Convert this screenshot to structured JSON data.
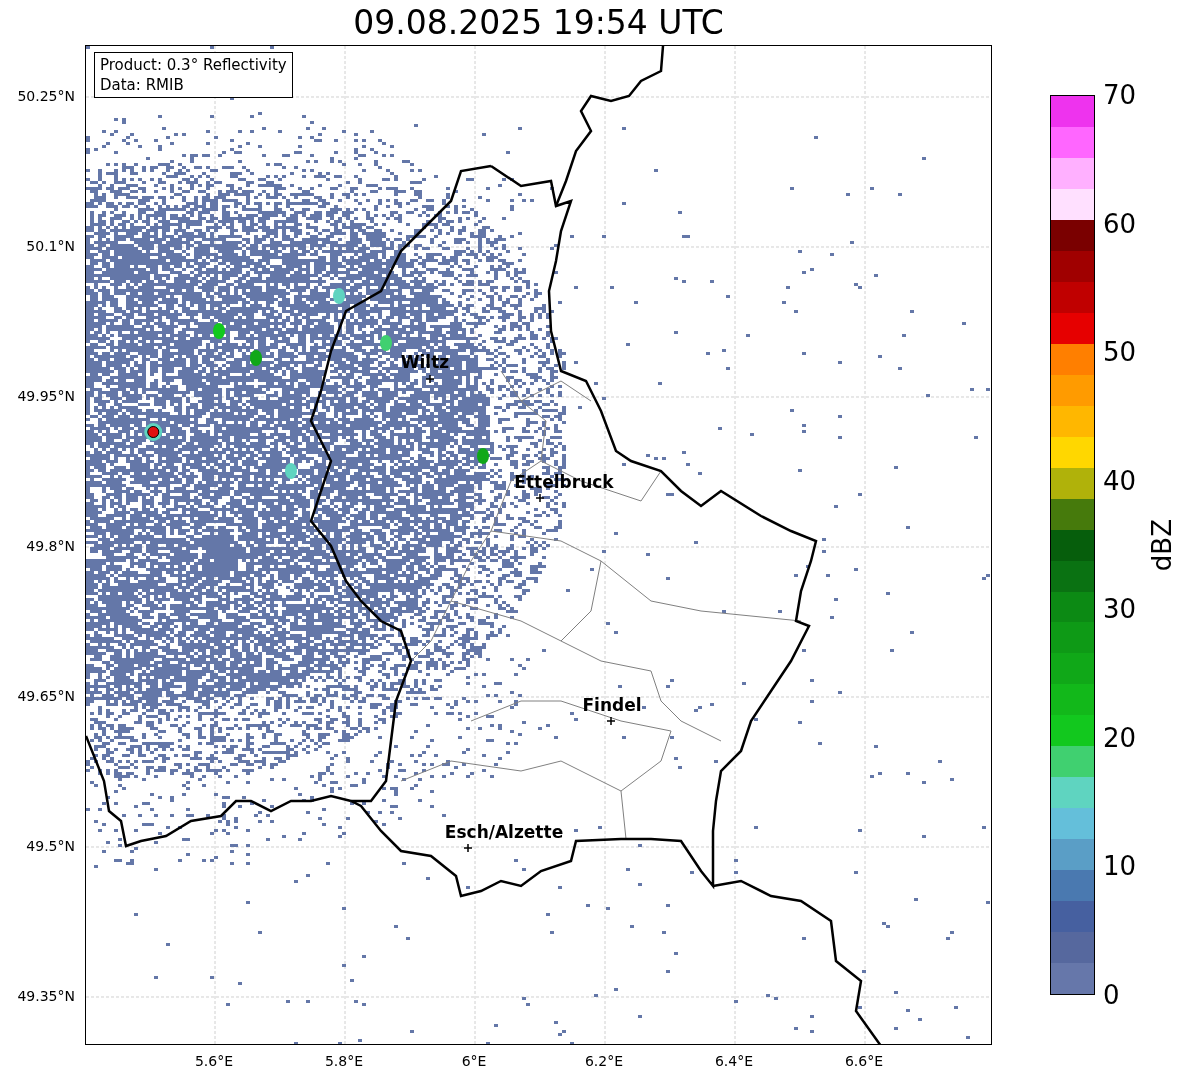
{
  "title": "09.08.2025 19:54 UTC",
  "info_box": {
    "lines": [
      "Product: 0.3° Reflectivity",
      "Data: RMIB"
    ]
  },
  "cities": [
    {
      "name": "Wiltz"
    },
    {
      "name": "Ettelbruck"
    },
    {
      "name": "Findel"
    },
    {
      "name": "Esch/Alzette"
    }
  ],
  "y_ticks": [
    "50.25°N",
    "50.1°N",
    "49.95°N",
    "49.8°N",
    "49.65°N",
    "49.5°N",
    "49.35°N"
  ],
  "x_ticks": [
    "5.6°E",
    "5.8°E",
    "6°E",
    "6.2°E",
    "6.4°E",
    "6.6°E"
  ],
  "colorbar": {
    "label": "dBZ",
    "ticks": [
      "70",
      "60",
      "50",
      "40",
      "30",
      "20",
      "10",
      "0"
    ],
    "bands": [
      {
        "color": "#ee33ee"
      },
      {
        "color": "#ff66ff"
      },
      {
        "color": "#ffb0ff"
      },
      {
        "color": "#ffe0ff"
      },
      {
        "color": "#7a0000"
      },
      {
        "color": "#a00000"
      },
      {
        "color": "#c00000"
      },
      {
        "color": "#e60000"
      },
      {
        "color": "#ff7f00"
      },
      {
        "color": "#ff9b00"
      },
      {
        "color": "#ffb700"
      },
      {
        "color": "#ffd700"
      },
      {
        "color": "#b0b20a"
      },
      {
        "color": "#467a0c"
      },
      {
        "color": "#065e0c"
      },
      {
        "color": "#0a7212"
      },
      {
        "color": "#0c8a14"
      },
      {
        "color": "#0e9a16"
      },
      {
        "color": "#10a818"
      },
      {
        "color": "#12b81a"
      },
      {
        "color": "#12c81e"
      },
      {
        "color": "#40d070"
      },
      {
        "color": "#5fd4c0"
      },
      {
        "color": "#64bfda"
      },
      {
        "color": "#5a9ec6"
      },
      {
        "color": "#4a79b0"
      },
      {
        "color": "#4660a0"
      },
      {
        "color": "#56689e"
      },
      {
        "color": "#6677aa"
      }
    ]
  }
}
